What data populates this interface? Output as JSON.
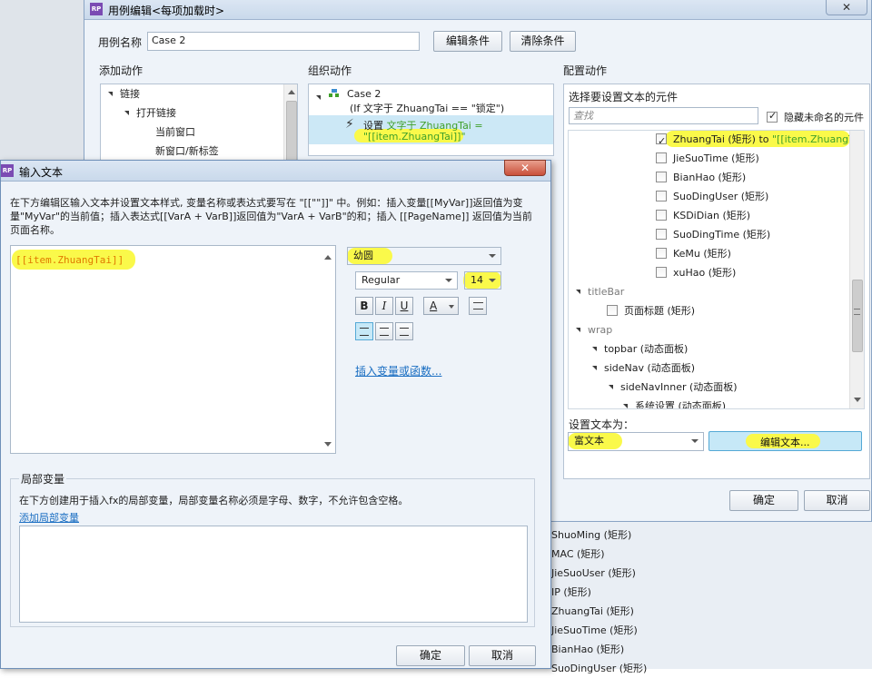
{
  "background_list": {
    "items": [
      "ShuoMing (矩形)",
      "MAC (矩形)",
      "JieSuoUser (矩形)",
      "IP (矩形)",
      "ZhuangTai (矩形)",
      "JieSuoTime (矩形)",
      "BianHao (矩形)",
      "SuoDingUser (矩形)"
    ]
  },
  "case_editor": {
    "title": "用例编辑<每项加载时>",
    "case_name_label": "用例名称",
    "case_name_value": "Case 2",
    "edit_condition_label": "编辑条件",
    "clear_condition_label": "清除条件",
    "add_actions_label": "添加动作",
    "organize_actions_label": "组织动作",
    "configure_actions_label": "配置动作",
    "add_actions_tree": [
      {
        "label": "链接",
        "level": 0,
        "expanded": true
      },
      {
        "label": "打开链接",
        "level": 1,
        "expanded": true
      },
      {
        "label": "当前窗口",
        "level": 2
      },
      {
        "label": "新窗口/新标签",
        "level": 2
      }
    ],
    "organize": {
      "case_name": "Case 2",
      "condition": "(If 文字于 ZhuangTai == \"锁定\")",
      "action_verb": "设置",
      "action_text_line1": "文字于 ZhuangTai =",
      "action_text_line2": "\"[[item.ZhuangTai]]\""
    },
    "configure": {
      "select_widget_label": "选择要设置文本的元件",
      "search_placeholder": "查找",
      "hide_unnamed_label": "隐藏未命名的元件",
      "hide_unnamed_checked": true,
      "widget_rows": [
        {
          "label": "ZhuangTai (矩形) to ",
          "value": "\"[[item.ZhuangTai]]\"",
          "checked": true,
          "type": "checkbox"
        },
        {
          "label": "JieSuoTime (矩形)",
          "checked": false,
          "type": "checkbox"
        },
        {
          "label": "BianHao (矩形)",
          "checked": false,
          "type": "checkbox"
        },
        {
          "label": "SuoDingUser (矩形)",
          "checked": false,
          "type": "checkbox"
        },
        {
          "label": "KSDiDian (矩形)",
          "checked": false,
          "type": "checkbox"
        },
        {
          "label": "SuoDingTime (矩形)",
          "checked": false,
          "type": "checkbox"
        },
        {
          "label": "KeMu (矩形)",
          "checked": false,
          "type": "checkbox"
        },
        {
          "label": "xuHao (矩形)",
          "checked": false,
          "type": "checkbox"
        },
        {
          "label": "titleBar",
          "type": "group"
        },
        {
          "label": "页面标题 (矩形)",
          "checked": false,
          "type": "checkbox"
        },
        {
          "label": "wrap",
          "type": "group"
        },
        {
          "label": "topbar (动态面板)",
          "type": "node"
        },
        {
          "label": "sideNav (动态面板)",
          "type": "node"
        },
        {
          "label": "sideNavInner (动态面板)",
          "type": "node"
        },
        {
          "label": "系统设置 (动态面板)",
          "type": "node"
        }
      ],
      "set_text_label": "设置文本为：",
      "set_text_type": "富文本",
      "edit_text_button": "编辑文本..."
    },
    "ok_label": "确定",
    "cancel_label": "取消"
  },
  "input_text_dialog": {
    "title": "输入文本",
    "instructions": "在下方编辑区输入文本并设置文本样式, 变量名称或表达式要写在 \"[[\"\"]]\" 中。例如：插入变量[[MyVar]]返回值为变量\"MyVar\"的当前值；插入表达式[[VarA + VarB]]返回值为\"VarA + VarB\"的和；插入 [[PageName]] 返回值为当前页面名称。",
    "editor_text": "[[item.ZhuangTai]]",
    "font_family": "幼圆",
    "font_style": "Regular",
    "font_size": "14",
    "bold": "B",
    "italic": "I",
    "underline": "U",
    "font_color_letter": "A",
    "insert_variable_link": "插入变量或函数...",
    "local_vars_title": "局部变量",
    "local_vars_desc": "在下方创建用于插入fx的局部变量，局部变量名称必须是字母、数字，不允许包含空格。",
    "add_local_var_link": "添加局部变量",
    "ok_label": "确定",
    "cancel_label": "取消",
    "colors": {
      "highlight": "#faf94a",
      "orange_text": "#e07a00",
      "link": "#1a6ec2"
    }
  }
}
